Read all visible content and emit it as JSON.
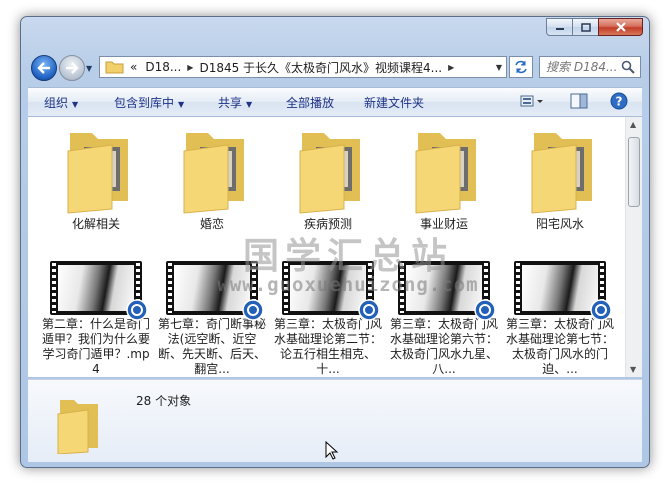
{
  "address": {
    "back_icon": "back-arrow-icon",
    "segments": [
      "D18...",
      "D1845 于长久《太极奇门风水》视频课程4..."
    ],
    "overflow_marker": "«"
  },
  "search": {
    "placeholder": "搜索 D184..."
  },
  "toolbar": {
    "organize": "组织",
    "include_library": "包含到库中",
    "share": "共享",
    "play_all": "全部播放",
    "new_folder": "新建文件夹"
  },
  "folders": [
    {
      "label": "化解相关"
    },
    {
      "label": "婚恋"
    },
    {
      "label": "疾病预测"
    },
    {
      "label": "事业财运"
    },
    {
      "label": "阳宅风水"
    }
  ],
  "videos": [
    {
      "label": "第二章：什么是奇门遁甲？我们为什么要学习奇门遁甲？.mp4"
    },
    {
      "label": "第七章：奇门断事秘法(远空断、近空断、先天断、后天、翻宫..."
    },
    {
      "label": "第三章：太极奇门风水基础理论第二节：论五行相生相克、十..."
    },
    {
      "label": "第三章：太极奇门风水基础理论第六节：太极奇门风水九星、八..."
    },
    {
      "label": "第三章：太极奇门风水基础理论第七节：太极奇门风水的门迫、..."
    }
  ],
  "watermark": {
    "line1": "国学汇总站",
    "line2": "www.guoxuehuizong.com"
  },
  "details": {
    "count": "28 个对象"
  },
  "colors": {
    "accent": "#1e3287",
    "frame": "#aec7e5",
    "folder": "#f6d776"
  }
}
